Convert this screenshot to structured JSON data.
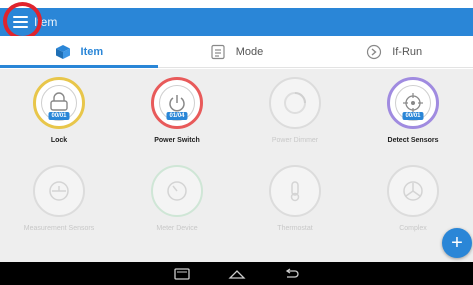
{
  "app": {
    "title": "Item"
  },
  "tabs": [
    {
      "label": "Item",
      "icon": "cube-icon",
      "active": true
    },
    {
      "label": "Mode",
      "icon": "mode-icon",
      "active": false
    },
    {
      "label": "If-Run",
      "icon": "if-run-icon",
      "active": false
    }
  ],
  "tiles": [
    {
      "label": "Lock",
      "badge": "00/01",
      "active": true,
      "ring_color": "#e8c64a",
      "icon": "lock-icon"
    },
    {
      "label": "Power Switch",
      "badge": "01/04",
      "active": true,
      "ring_color": "#e85a5a",
      "icon": "power-icon"
    },
    {
      "label": "Power Dimmer",
      "badge": "",
      "active": false,
      "ring_color": "#dcdcdc",
      "icon": "dimmer-icon"
    },
    {
      "label": "Detect Sensors",
      "badge": "00/01",
      "active": true,
      "ring_color": "#a08be0",
      "icon": "sensor-icon"
    },
    {
      "label": "Measurement Sensors",
      "badge": "",
      "active": false,
      "ring_color": "#dcdcdc",
      "icon": "measurement-icon"
    },
    {
      "label": "Meter Device",
      "badge": "",
      "active": false,
      "ring_color": "#cfe6d6",
      "icon": "meter-icon"
    },
    {
      "label": "Thermostat",
      "badge": "",
      "active": false,
      "ring_color": "#dcdcdc",
      "icon": "thermostat-icon"
    },
    {
      "label": "Complex",
      "badge": "",
      "active": false,
      "ring_color": "#dcdcdc",
      "icon": "complex-icon"
    }
  ],
  "fab": {
    "label": "+"
  },
  "colors": {
    "accent": "#2a86d7",
    "highlight": "#e0242d"
  }
}
